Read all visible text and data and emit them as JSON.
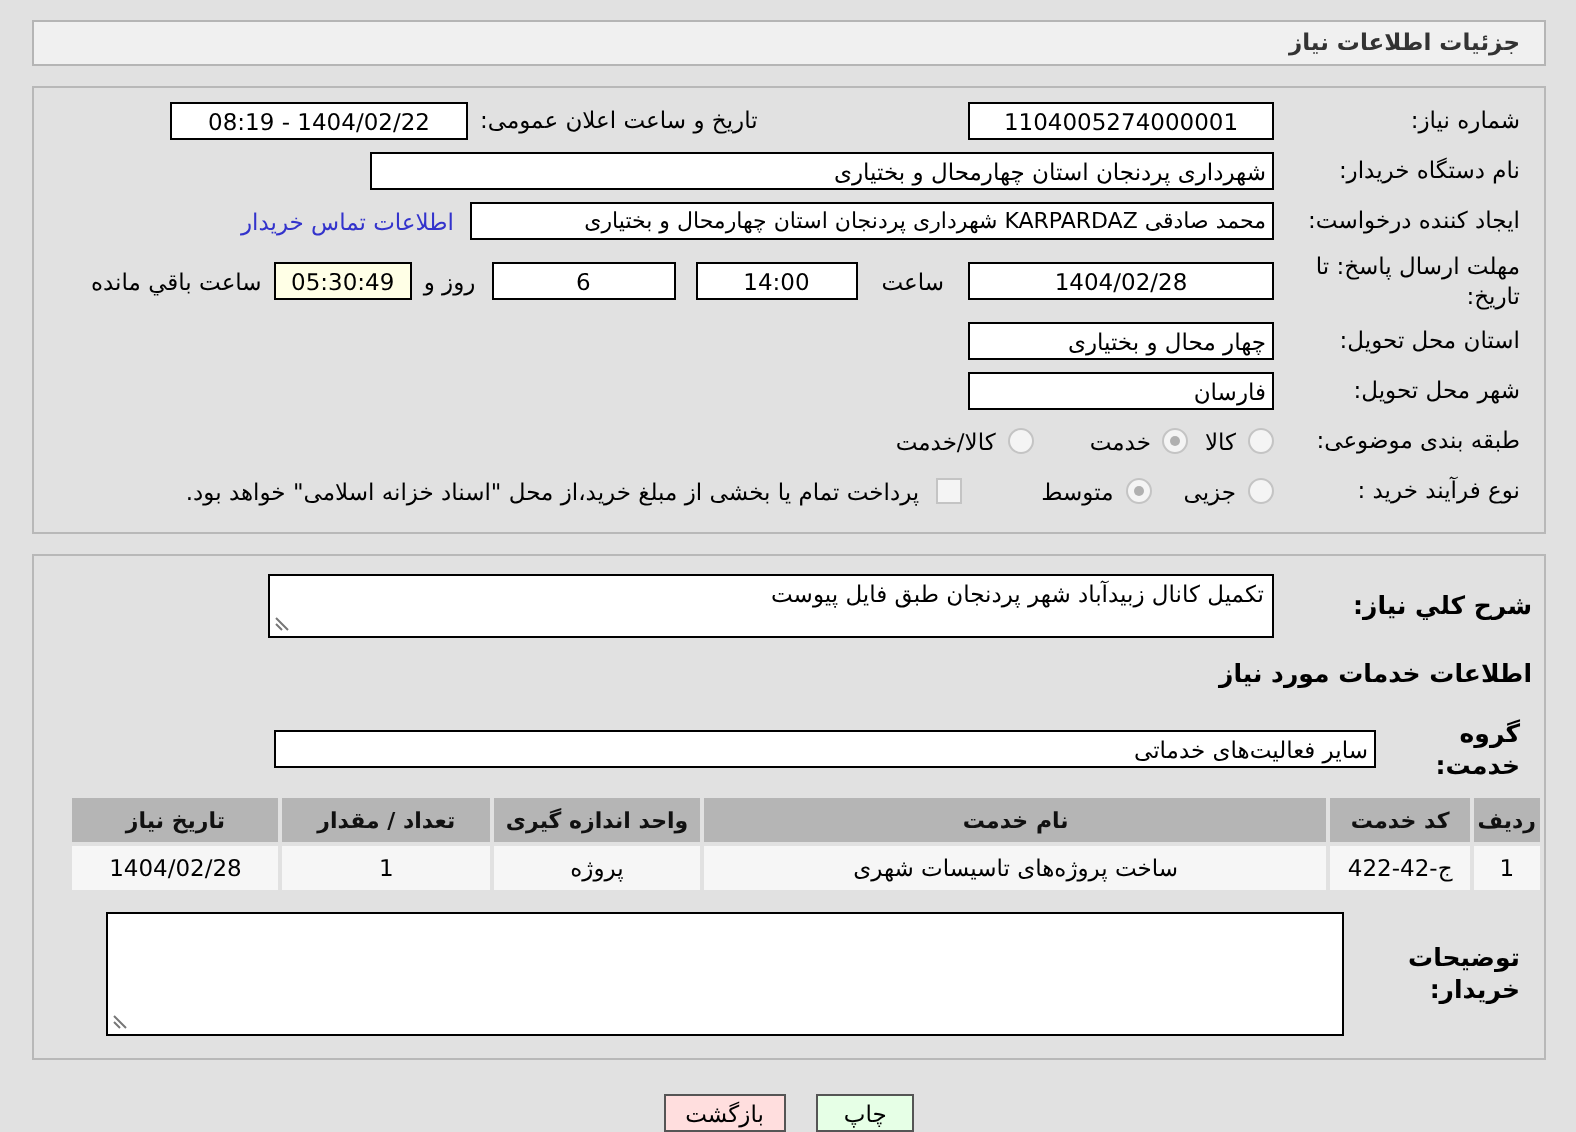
{
  "header": {
    "title": "جزئیات اطلاعات نیاز"
  },
  "form": {
    "need_number": {
      "label": "شماره نیاز:",
      "value": "1104005274000001"
    },
    "announce": {
      "label": "تاریخ و ساعت اعلان عمومی:",
      "value": "1404/02/22 - 08:19"
    },
    "buyer": {
      "label": "نام دستگاه خریدار:",
      "value": "شهرداری پردنجان استان چهارمحال و بختیاری"
    },
    "creator": {
      "label": "ایجاد کننده درخواست:",
      "value": "محمد صادقی KARPARDAZ شهرداری پردنجان استان چهارمحال و بختیاری",
      "link": "اطلاعات تماس خریدار"
    },
    "deadline": {
      "label": "مهلت ارسال پاسخ: تا تاریخ:",
      "date": "1404/02/28",
      "time_label": "ساعت",
      "time": "14:00",
      "days": "6",
      "days_label": "روز و",
      "remaining": "05:30:49",
      "remaining_label": "ساعت باقي مانده"
    },
    "province": {
      "label": "استان محل تحویل:",
      "value": "چهار محال و بختیاری"
    },
    "city": {
      "label": "شهر محل تحویل:",
      "value": "فارسان"
    },
    "category": {
      "label": "طبقه بندی موضوعی:",
      "options": [
        {
          "label": "کالا",
          "selected": false
        },
        {
          "label": "خدمت",
          "selected": true
        },
        {
          "label": "کالا/خدمت",
          "selected": false
        }
      ]
    },
    "process": {
      "label": "نوع فرآیند خرید :",
      "options": [
        {
          "label": "جزیی",
          "selected": false
        },
        {
          "label": "متوسط",
          "selected": true
        }
      ],
      "payment": {
        "checked": false,
        "label": "پرداخت تمام یا بخشی از مبلغ خرید،از محل \"اسناد خزانه اسلامی\" خواهد بود."
      }
    }
  },
  "details": {
    "description": {
      "label": "شرح کلي نياز:",
      "value": "تکمیل کانال زبیدآباد شهر پردنجان طبق فایل پیوست"
    },
    "services_heading": "اطلاعات خدمات مورد نیاز",
    "service_group": {
      "label": "گروه خدمت:",
      "value": "سایر فعالیت‌های خدماتی"
    },
    "table": {
      "columns": [
        "ردیف",
        "کد خدمت",
        "نام خدمت",
        "واحد اندازه گیری",
        "تعداد / مقدار",
        "تاریخ نیاز"
      ],
      "rows": [
        [
          "1",
          "ج-42-422",
          "ساخت پروژه‌های تاسیسات شهری",
          "پروژه",
          "1",
          "1404/02/28"
        ]
      ]
    },
    "buyer_notes": {
      "label": "توضیحات خریدار:"
    }
  },
  "buttons": [
    {
      "label": "چاپ",
      "kind": "print"
    },
    {
      "label": "بازگشت",
      "kind": "back"
    }
  ]
}
